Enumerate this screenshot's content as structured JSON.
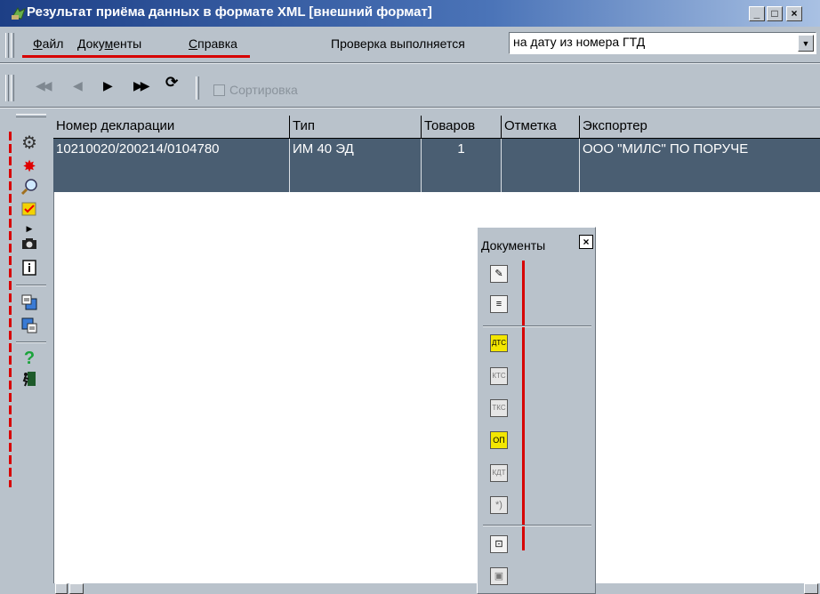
{
  "window": {
    "title": "Результат приёма данных в формате XML [внешний формат]",
    "minimize_label": "_",
    "maximize_label": "□",
    "close_label": "×"
  },
  "menu": {
    "file": {
      "underlined": "Ф",
      "rest": "айл"
    },
    "documents": {
      "before": "Доку",
      "underlined": "м",
      "rest": "енты"
    },
    "help": {
      "underlined": "С",
      "rest": "правка"
    }
  },
  "check": {
    "label": "Проверка выполняется",
    "value": "на дату из номера ГТД",
    "arrow": "▼"
  },
  "nav_toolbar": {
    "first": "◀◀",
    "prev": "◀",
    "next": "▶",
    "last": "▶▶",
    "refresh": "⟳",
    "sort_label": "Сортировка"
  },
  "left_toolbar": [
    "settings-icon",
    "burst-icon",
    "magnifier-icon",
    "checkbox-icon",
    "small-arrow-icon",
    "camera-icon",
    "info-icon",
    "export-icon",
    "import-icon",
    "help-icon",
    "exit-icon"
  ],
  "grid": {
    "columns": [
      "Номер декларации",
      "Тип",
      "Товаров",
      "Отметка",
      "Экспортер"
    ],
    "rows": [
      {
        "number": "10210020/200214/0104780",
        "type": "ИМ 40 ЭД",
        "goods": "1",
        "mark": "",
        "exporter": "ООО \"МИЛС\" ПО ПОРУЧЕ"
      }
    ]
  },
  "docs_panel": {
    "title": "Документы",
    "close": "×",
    "icons": [
      {
        "name": "doc-edit-icon",
        "label": "✎"
      },
      {
        "name": "doc-list-icon",
        "label": "≡"
      },
      {
        "name": "dts-icon",
        "label": "ДТС"
      },
      {
        "name": "kts-icon",
        "label": "КТС"
      },
      {
        "name": "tks-icon",
        "label": "ТКС"
      },
      {
        "name": "op-icon",
        "label": "ОП"
      },
      {
        "name": "kdt-icon",
        "label": "КДТ"
      },
      {
        "name": "quote-icon",
        "label": "*)"
      },
      {
        "name": "xml-doc-icon",
        "label": "⊡"
      },
      {
        "name": "save-icon",
        "label": "▣"
      }
    ]
  },
  "colors": {
    "accent_red": "#d70000",
    "selection": "#4a5e72",
    "title_start": "#1d3f86"
  }
}
